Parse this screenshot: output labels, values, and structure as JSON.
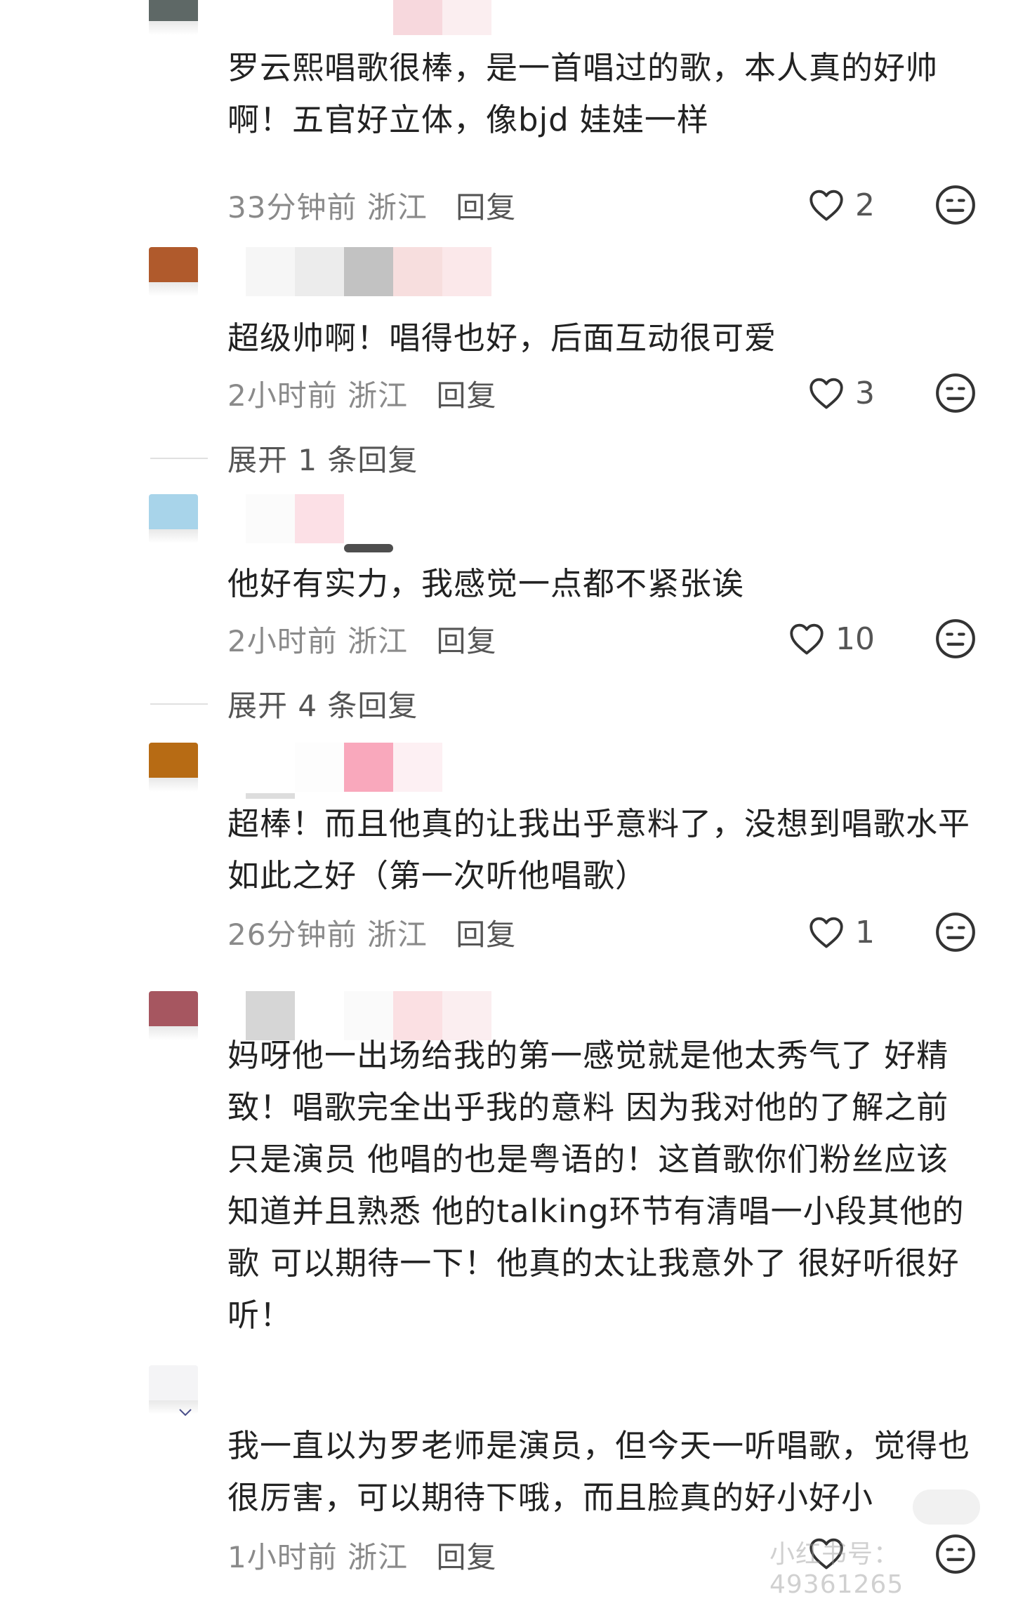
{
  "comments": [
    {
      "avatar_color": "#5e6866",
      "name_colors": [
        "#f7d8dd",
        "#fbeef0"
      ],
      "text": "罗云熙唱歌很棒，是一首唱过的歌，本人真的好帅啊！五官好立体，像bjd 娃娃一样",
      "time": "33分钟前",
      "location": "浙江",
      "reply_label": "回复",
      "likes": "2"
    },
    {
      "avatar_color": "#b05a2c",
      "name_colors": [
        "#f6f6f6",
        "#ececec",
        "#c2c2c2",
        "#f7dede",
        "#fbe8ea"
      ],
      "text": "超级帅啊！唱得也好，后面互动很可爱",
      "time": "2小时前",
      "location": "浙江",
      "reply_label": "回复",
      "likes": "3",
      "expand_label": "展开 1 条回复"
    },
    {
      "avatar_color": "#a8d4ea",
      "name_colors": [
        "#fbfbfb",
        "#fce0e6"
      ],
      "text": "他好有实力，我感觉一点都不紧张诶",
      "time": "2小时前",
      "location": "浙江",
      "reply_label": "回复",
      "likes": "10",
      "expand_label": "展开 4 条回复"
    },
    {
      "avatar_color": "#b76b14",
      "name_colors": [
        "#fdfdfd",
        "#f9a8bc",
        "#fdf0f3"
      ],
      "text": "超棒！而且他真的让我出乎意料了，没想到唱歌水平如此之好（第一次听他唱歌）",
      "time": "26分钟前",
      "location": "浙江",
      "reply_label": "回复",
      "likes": "1"
    },
    {
      "avatar_color": "#a65660",
      "name_colors": [
        "#d6d6d6",
        "#ffffff",
        "#fafafa",
        "#fbe0e3",
        "#fbeef0"
      ],
      "text": "妈呀他一出场给我的第一感觉就是他太秀气了 好精致！唱歌完全出乎我的意料 因为我对他的了解之前只是演员 他唱的也是粤语的！这首歌你们粉丝应该知道并且熟悉 他的talking环节有清唱一小段其他的歌 可以期待一下！他真的太让我意外了 很好听很好听！"
    },
    {
      "avatar_color": "#f4f4f6",
      "name_colors": [],
      "text": "我一直以为罗老师是演员，但今天一听唱歌，觉得也很厉害，可以期待下哦，而且脸真的好小好小",
      "time": "1小时前",
      "location": "浙江",
      "reply_label": "回复"
    }
  ],
  "watermark": "小红书号：49361265",
  "icons": {
    "like": "heart-icon",
    "dislike": "meh-face-icon"
  }
}
